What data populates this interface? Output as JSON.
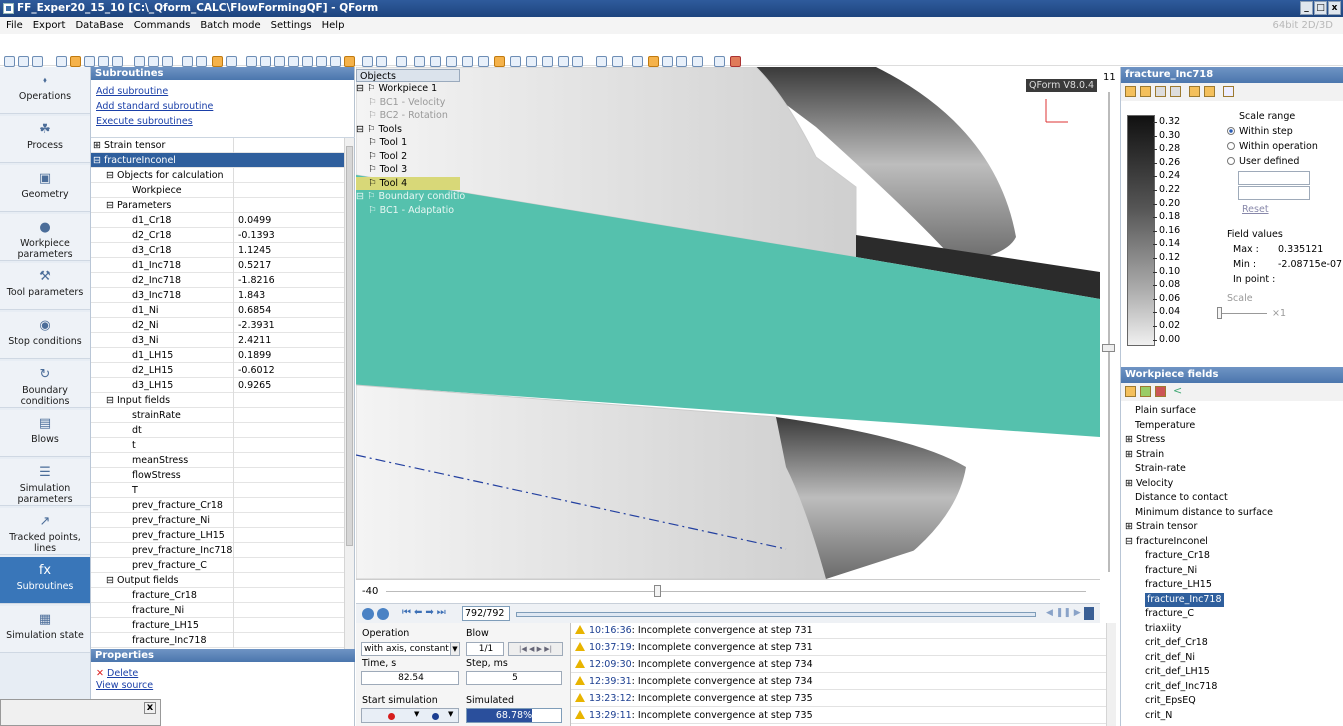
{
  "window": {
    "title": "FF_Exper20_15_10 [C:\\_Qform_CALC\\FlowFormingQF] - QForm",
    "buttons": [
      "_",
      "7",
      "x"
    ]
  },
  "menu": {
    "items": [
      "File",
      "Export",
      "DataBase",
      "Commands",
      "Batch mode",
      "Settings",
      "Help"
    ],
    "mode": "64bit 2D/3D"
  },
  "nav": [
    {
      "label": "Operations",
      "icon": "⬪"
    },
    {
      "label": "Process",
      "icon": "☘"
    },
    {
      "label": "Geometry",
      "icon": "▣"
    },
    {
      "label": "Workpiece parameters",
      "icon": "●"
    },
    {
      "label": "Tool parameters",
      "icon": "⚒"
    },
    {
      "label": "Stop conditions",
      "icon": "◉"
    },
    {
      "label": "Boundary conditions",
      "icon": "↻"
    },
    {
      "label": "Blows",
      "icon": "▤"
    },
    {
      "label": "Simulation parameters",
      "icon": "☰"
    },
    {
      "label": "Tracked points, lines",
      "icon": "↗"
    },
    {
      "label": "Subroutines",
      "icon": "fx"
    },
    {
      "label": "Simulation state",
      "icon": "▦"
    }
  ],
  "subroutines": {
    "title": "Subroutines",
    "links": [
      "Add subroutine",
      "Add standard subroutine",
      "Execute subroutines"
    ]
  },
  "tree": [
    {
      "label": "⊞ Strain tensor",
      "value": "",
      "indent": 0
    },
    {
      "label": "⊟ fractureInconel",
      "value": "",
      "indent": 0,
      "selected": true
    },
    {
      "label": "⊟ Objects for calculation",
      "value": "",
      "indent": 1
    },
    {
      "label": "Workpiece",
      "value": "",
      "indent": 3
    },
    {
      "label": "⊟ Parameters",
      "value": "",
      "indent": 1
    },
    {
      "label": "d1_Cr18",
      "value": "0.0499",
      "indent": 3
    },
    {
      "label": "d2_Cr18",
      "value": "-0.1393",
      "indent": 3
    },
    {
      "label": "d3_Cr18",
      "value": "1.1245",
      "indent": 3
    },
    {
      "label": "d1_Inc718",
      "value": "0.5217",
      "indent": 3
    },
    {
      "label": "d2_Inc718",
      "value": "-1.8216",
      "indent": 3
    },
    {
      "label": "d3_Inc718",
      "value": "1.843",
      "indent": 3
    },
    {
      "label": "d1_Ni",
      "value": "0.6854",
      "indent": 3
    },
    {
      "label": "d2_Ni",
      "value": "-2.3931",
      "indent": 3
    },
    {
      "label": "d3_Ni",
      "value": "2.4211",
      "indent": 3
    },
    {
      "label": "d1_LH15",
      "value": "0.1899",
      "indent": 3
    },
    {
      "label": "d2_LH15",
      "value": "-0.6012",
      "indent": 3
    },
    {
      "label": "d3_LH15",
      "value": "0.9265",
      "indent": 3
    },
    {
      "label": "⊟ Input fields",
      "value": "",
      "indent": 1
    },
    {
      "label": "strainRate",
      "value": "",
      "indent": 3
    },
    {
      "label": "dt",
      "value": "",
      "indent": 3
    },
    {
      "label": "t",
      "value": "",
      "indent": 3
    },
    {
      "label": "meanStress",
      "value": "",
      "indent": 3
    },
    {
      "label": "flowStress",
      "value": "",
      "indent": 3
    },
    {
      "label": "T",
      "value": "",
      "indent": 3
    },
    {
      "label": "prev_fracture_Cr18",
      "value": "",
      "indent": 3
    },
    {
      "label": "prev_fracture_Ni",
      "value": "",
      "indent": 3
    },
    {
      "label": "prev_fracture_LH15",
      "value": "",
      "indent": 3
    },
    {
      "label": "prev_fracture_Inc718",
      "value": "",
      "indent": 3
    },
    {
      "label": "prev_fracture_C",
      "value": "",
      "indent": 3
    },
    {
      "label": "⊟ Output fields",
      "value": "",
      "indent": 1
    },
    {
      "label": "fracture_Cr18",
      "value": "",
      "indent": 3
    },
    {
      "label": "fracture_Ni",
      "value": "",
      "indent": 3
    },
    {
      "label": "fracture_LH15",
      "value": "",
      "indent": 3
    },
    {
      "label": "fracture_Inc718",
      "value": "",
      "indent": 3
    }
  ],
  "properties": {
    "title": "Properties",
    "delete": "Delete",
    "view_source": "View source"
  },
  "objects": {
    "title": "Objects",
    "items": [
      {
        "label": "⊟ ⚐ Workpiece 1",
        "cls": ""
      },
      {
        "label": "    ⚐ BC1 - Velocity",
        "cls": "gray"
      },
      {
        "label": "    ⚐ BC2 - Rotation",
        "cls": "gray"
      },
      {
        "label": "⊟ ⚐ Tools",
        "cls": ""
      },
      {
        "label": "    ⚐ Tool 1",
        "cls": ""
      },
      {
        "label": "    ⚐ Tool 2",
        "cls": ""
      },
      {
        "label": "    ⚐ Tool 3",
        "cls": ""
      },
      {
        "label": "    ⚐ Tool 4",
        "cls": "hl"
      },
      {
        "label": "⊟ ⚐ Boundary conditio",
        "cls": "ghost"
      },
      {
        "label": "    ⚐ BC1 - Adaptatio",
        "cls": "ghost"
      }
    ]
  },
  "viewport": {
    "version": "QForm V8.0.4",
    "zoom_label": "11"
  },
  "slider": {
    "value": "-40"
  },
  "playback": {
    "step": "792/792"
  },
  "sim": {
    "operation_label": "Operation",
    "operation_value": "with axis, constant step",
    "blow_label": "Blow",
    "blow_value": "1/1",
    "time_label": "Time, s",
    "time_value": "82.54",
    "step_label": "Step, ms",
    "step_value": "5",
    "start_label": "Start simulation",
    "simulated_label": "Simulated",
    "simulated_value": "68.78%",
    "simulated_fraction": 0.6878
  },
  "log": [
    {
      "time": "10:16:36",
      "msg": ": Incomplete convergence at step 731"
    },
    {
      "time": "10:37:19",
      "msg": ": Incomplete convergence at step 731"
    },
    {
      "time": "12:09:30",
      "msg": ": Incomplete convergence at step 734"
    },
    {
      "time": "12:39:31",
      "msg": ": Incomplete convergence at step 734"
    },
    {
      "time": "13:23:12",
      "msg": ": Incomplete convergence at step 735"
    },
    {
      "time": "13:29:11",
      "msg": ": Incomplete convergence at step 735"
    }
  ],
  "field": {
    "title": "fracture_Inc718",
    "scale_ticks": [
      "0.32",
      "0.30",
      "0.28",
      "0.26",
      "0.24",
      "0.22",
      "0.20",
      "0.18",
      "0.16",
      "0.14",
      "0.12",
      "0.10",
      "0.08",
      "0.06",
      "0.04",
      "0.02",
      "0.00"
    ],
    "scale_range": "Scale range",
    "opt_within_step": "Within step",
    "opt_within_operation": "Within operation",
    "opt_user_defined": "User defined",
    "reset": "Reset",
    "field_values": "Field values",
    "max_label": "Max :",
    "max_value": "0.335121",
    "min_label": "Min :",
    "min_value": "-2.08715e-07",
    "inpoint_label": "In point :",
    "scale_label": "Scale",
    "scale_mult": "×1"
  },
  "wpfields": {
    "title": "Workpiece fields",
    "items": [
      {
        "label": "Plain surface",
        "indent": 1
      },
      {
        "label": "Temperature",
        "indent": 1
      },
      {
        "label": "⊞ Stress",
        "indent": 0
      },
      {
        "label": "⊞ Strain",
        "indent": 0
      },
      {
        "label": "Strain-rate",
        "indent": 1
      },
      {
        "label": "⊞ Velocity",
        "indent": 0
      },
      {
        "label": "Distance to contact",
        "indent": 1
      },
      {
        "label": "Minimum distance to surface",
        "indent": 1
      },
      {
        "label": "⊞ Strain tensor",
        "indent": 0
      },
      {
        "label": "⊟ fractureInconel",
        "indent": 0
      },
      {
        "label": "fracture_Cr18",
        "indent": 2
      },
      {
        "label": "fracture_Ni",
        "indent": 2
      },
      {
        "label": "fracture_LH15",
        "indent": 2
      },
      {
        "label": "fracture_Inc718",
        "indent": 2,
        "selected": true
      },
      {
        "label": "fracture_C",
        "indent": 2
      },
      {
        "label": "triaxiity",
        "indent": 2
      },
      {
        "label": "crit_def_Cr18",
        "indent": 2
      },
      {
        "label": "crit_def_Ni",
        "indent": 2
      },
      {
        "label": "crit_def_LH15",
        "indent": 2
      },
      {
        "label": "crit_def_Inc718",
        "indent": 2
      },
      {
        "label": "crit_EpsEQ",
        "indent": 2
      },
      {
        "label": "crit_N",
        "indent": 2
      }
    ]
  }
}
